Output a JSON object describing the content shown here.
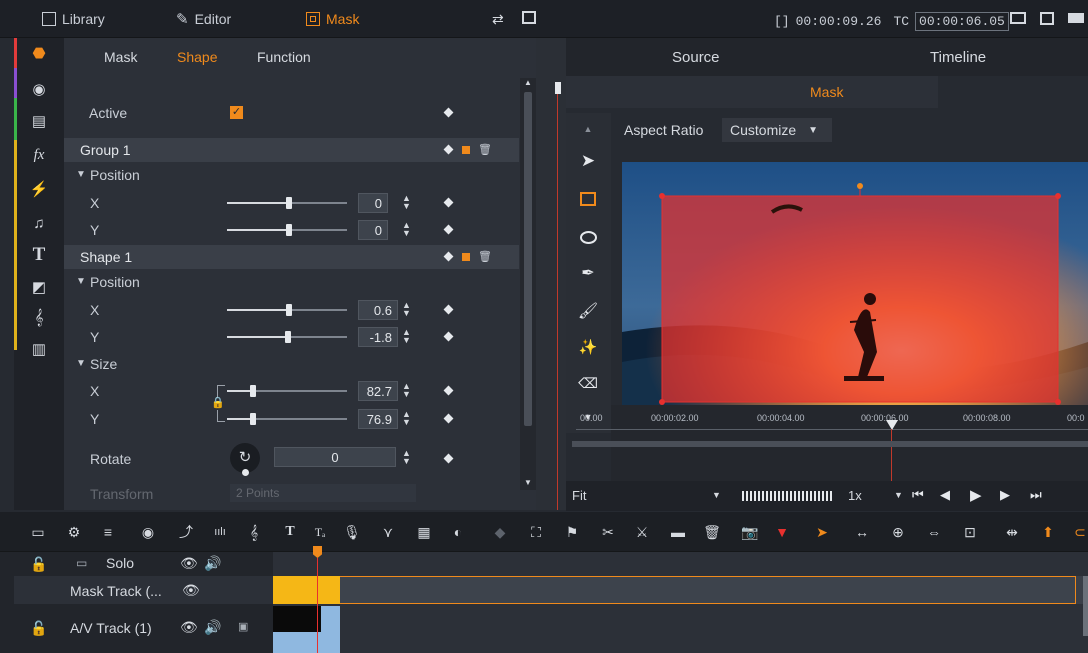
{
  "top_tabs": {
    "library": "Library",
    "editor": "Editor",
    "mask": "Mask"
  },
  "timecode": {
    "bracket": "[]",
    "duration": "00:00:09.26",
    "tc_label": "TC",
    "current": "00:00:06.05"
  },
  "subtabs": [
    "Mask",
    "Shape",
    "Function"
  ],
  "props": {
    "active_label": "Active",
    "group1_label": "Group 1",
    "position_label": "Position",
    "x_label": "X",
    "y_label": "Y",
    "g_pos_x": "0",
    "g_pos_y": "0",
    "shape1_label": "Shape 1",
    "s_position_label": "Position",
    "s_pos_x": "0.6",
    "s_pos_y": "-1.8",
    "size_label": "Size",
    "size_x": "82.7",
    "size_y": "76.9",
    "rotate_label": "Rotate",
    "rotate_value": "0",
    "transform_label": "Transform",
    "transform_value": "2 Points"
  },
  "preview": {
    "source_tab": "Source",
    "timeline_tab": "Timeline",
    "mask_tab": "Mask",
    "aspect_label": "Aspect Ratio",
    "aspect_value": "Customize",
    "ruler": [
      "00.00",
      "00:00:02.00",
      "00:00:04.00",
      "00:00:06.00",
      "00:00:08.00",
      "00:0"
    ],
    "fit_value": "Fit",
    "speed_value": "1x"
  },
  "tracks": {
    "solo_label": "Solo",
    "mask_track_label": "Mask Track (...",
    "av_track_label": "A/V Track (1)"
  },
  "colors": {
    "accent": "#f08a1c",
    "mask_overlay": "#e8302e"
  }
}
